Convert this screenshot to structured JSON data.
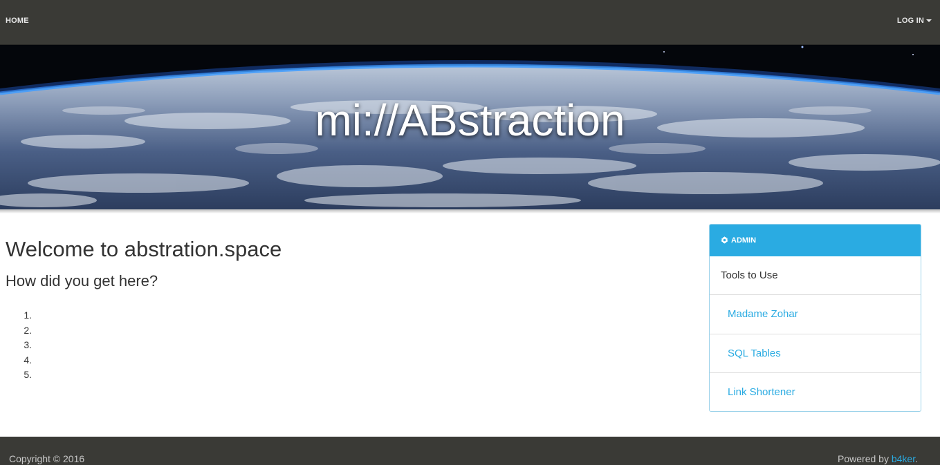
{
  "nav": {
    "home_label": "HOME",
    "login_label": "LOG IN"
  },
  "hero": {
    "title": "mi://ABstraction"
  },
  "main": {
    "heading": "Welcome to abstration.space",
    "subheading": "How did you get here?",
    "steps": [
      "1.",
      "2.",
      "3.",
      "4.",
      "5."
    ]
  },
  "admin_panel": {
    "title": "ADMIN",
    "icon": "gear-icon",
    "section_label": "Tools to Use",
    "links": [
      "Madame Zohar",
      "SQL Tables",
      "Link Shortener"
    ]
  },
  "footer": {
    "copyright": "Copyright © 2016",
    "powered_prefix": "Powered by ",
    "powered_link": "b4ker",
    "powered_suffix": "."
  },
  "colors": {
    "navbar": "#3a3a36",
    "accent": "#2aabe2",
    "text": "#333333"
  }
}
